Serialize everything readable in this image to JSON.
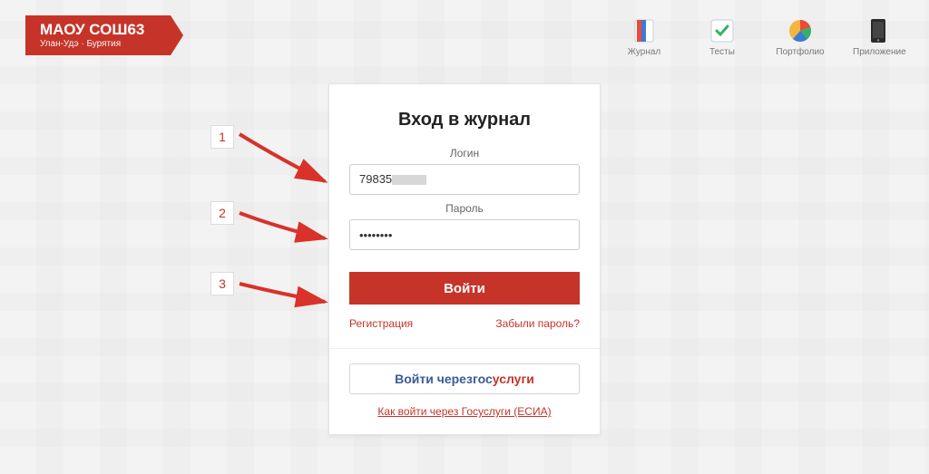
{
  "ribbon": {
    "title": "МАОУ СОШ63",
    "sub": "Улан-Удэ · Бурятия"
  },
  "topnav": {
    "journal": "Журнал",
    "tests": "Тесты",
    "portfolio": "Портфолио",
    "app": "Приложение"
  },
  "login": {
    "heading": "Вход в журнал",
    "login_label": "Логин",
    "login_value": "79835",
    "password_label": "Пароль",
    "password_value": "••••••••",
    "button": "Войти",
    "register": "Регистрация",
    "forgot": "Забыли пароль?",
    "gos_prefix": "Войти через ",
    "gos_part2": "гос",
    "gos_part3": "услуги",
    "gos_how": "Как войти через Госуслуги (ЕСИА)"
  },
  "anno": {
    "n1": "1",
    "n2": "2",
    "n3": "3"
  }
}
